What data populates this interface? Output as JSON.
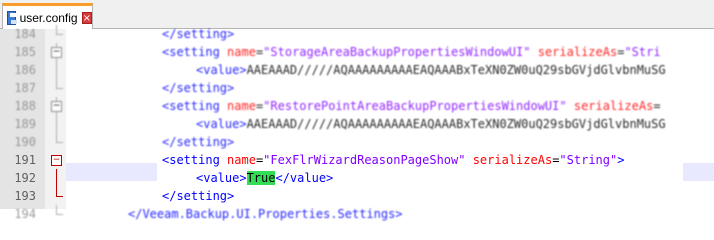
{
  "tab": {
    "label": "user.config",
    "close_glyph": "×"
  },
  "lines": [
    {
      "n": "184",
      "indent": 162,
      "parts": [
        [
          "tg",
          "</setting>"
        ]
      ]
    },
    {
      "n": "185",
      "indent": 162,
      "parts": [
        [
          "tg",
          "<setting "
        ],
        [
          "an",
          "name"
        ],
        [
          "tx",
          "="
        ],
        [
          "av",
          "\"StorageAreaBackupPropertiesWindowUI\""
        ],
        [
          "tx",
          " "
        ],
        [
          "an",
          "serializeAs"
        ],
        [
          "tx",
          "="
        ],
        [
          "av",
          "\"Stri"
        ]
      ]
    },
    {
      "n": "186",
      "indent": 196,
      "parts": [
        [
          "tg",
          "<value>"
        ],
        [
          "tx",
          "AAEAAAD/////AQAAAAAAAAAEAQAAABxTeXN0ZW0uQ29sbGVjdGlvbnMuSG"
        ]
      ]
    },
    {
      "n": "187",
      "indent": 162,
      "parts": [
        [
          "tg",
          "</setting>"
        ]
      ]
    },
    {
      "n": "188",
      "indent": 162,
      "parts": [
        [
          "tg",
          "<setting "
        ],
        [
          "an",
          "name"
        ],
        [
          "tx",
          "="
        ],
        [
          "av",
          "\"RestorePointAreaBackupPropertiesWindowUI\""
        ],
        [
          "tx",
          " "
        ],
        [
          "an",
          "serializeAs"
        ],
        [
          "tx",
          "="
        ]
      ]
    },
    {
      "n": "189",
      "indent": 196,
      "parts": [
        [
          "tg",
          "<value>"
        ],
        [
          "tx",
          "AAEAAAD/////AQAAAAAAAAAEAQAAABxTeXN0ZW0uQ29sbGVjdGlvbnMuSG"
        ]
      ]
    },
    {
      "n": "190",
      "indent": 162,
      "parts": [
        [
          "tg",
          "</setting>"
        ]
      ]
    },
    {
      "n": "191",
      "indent": 162,
      "parts": [
        [
          "tg",
          "<setting "
        ],
        [
          "an",
          "name"
        ],
        [
          "tx",
          "="
        ],
        [
          "av",
          "\"FexFlrWizardReasonPageShow\""
        ],
        [
          "tx",
          " "
        ],
        [
          "an",
          "serializeAs"
        ],
        [
          "tx",
          "="
        ],
        [
          "av",
          "\"String\""
        ],
        [
          "tg",
          ">"
        ]
      ]
    },
    {
      "n": "192",
      "indent": 196,
      "parts": [
        [
          "tg",
          "<value>"
        ],
        [
          "hl",
          "True"
        ],
        [
          "tg",
          "</value>"
        ]
      ]
    },
    {
      "n": "193",
      "indent": 162,
      "parts": [
        [
          "tg",
          "</setting>"
        ]
      ]
    },
    {
      "n": "194",
      "indent": 128,
      "parts": [
        [
          "tg",
          "</Veeam.Backup.UI.Properties.Settings>"
        ]
      ]
    }
  ],
  "colors": {
    "tag": "#0000ff",
    "attr_name": "#ff0000",
    "attr_value": "#8000ff",
    "text": "#000000",
    "match_highlight": "#33dd55",
    "current_line": "#e8e8ff",
    "tab_accent": "#fa9c2b"
  }
}
